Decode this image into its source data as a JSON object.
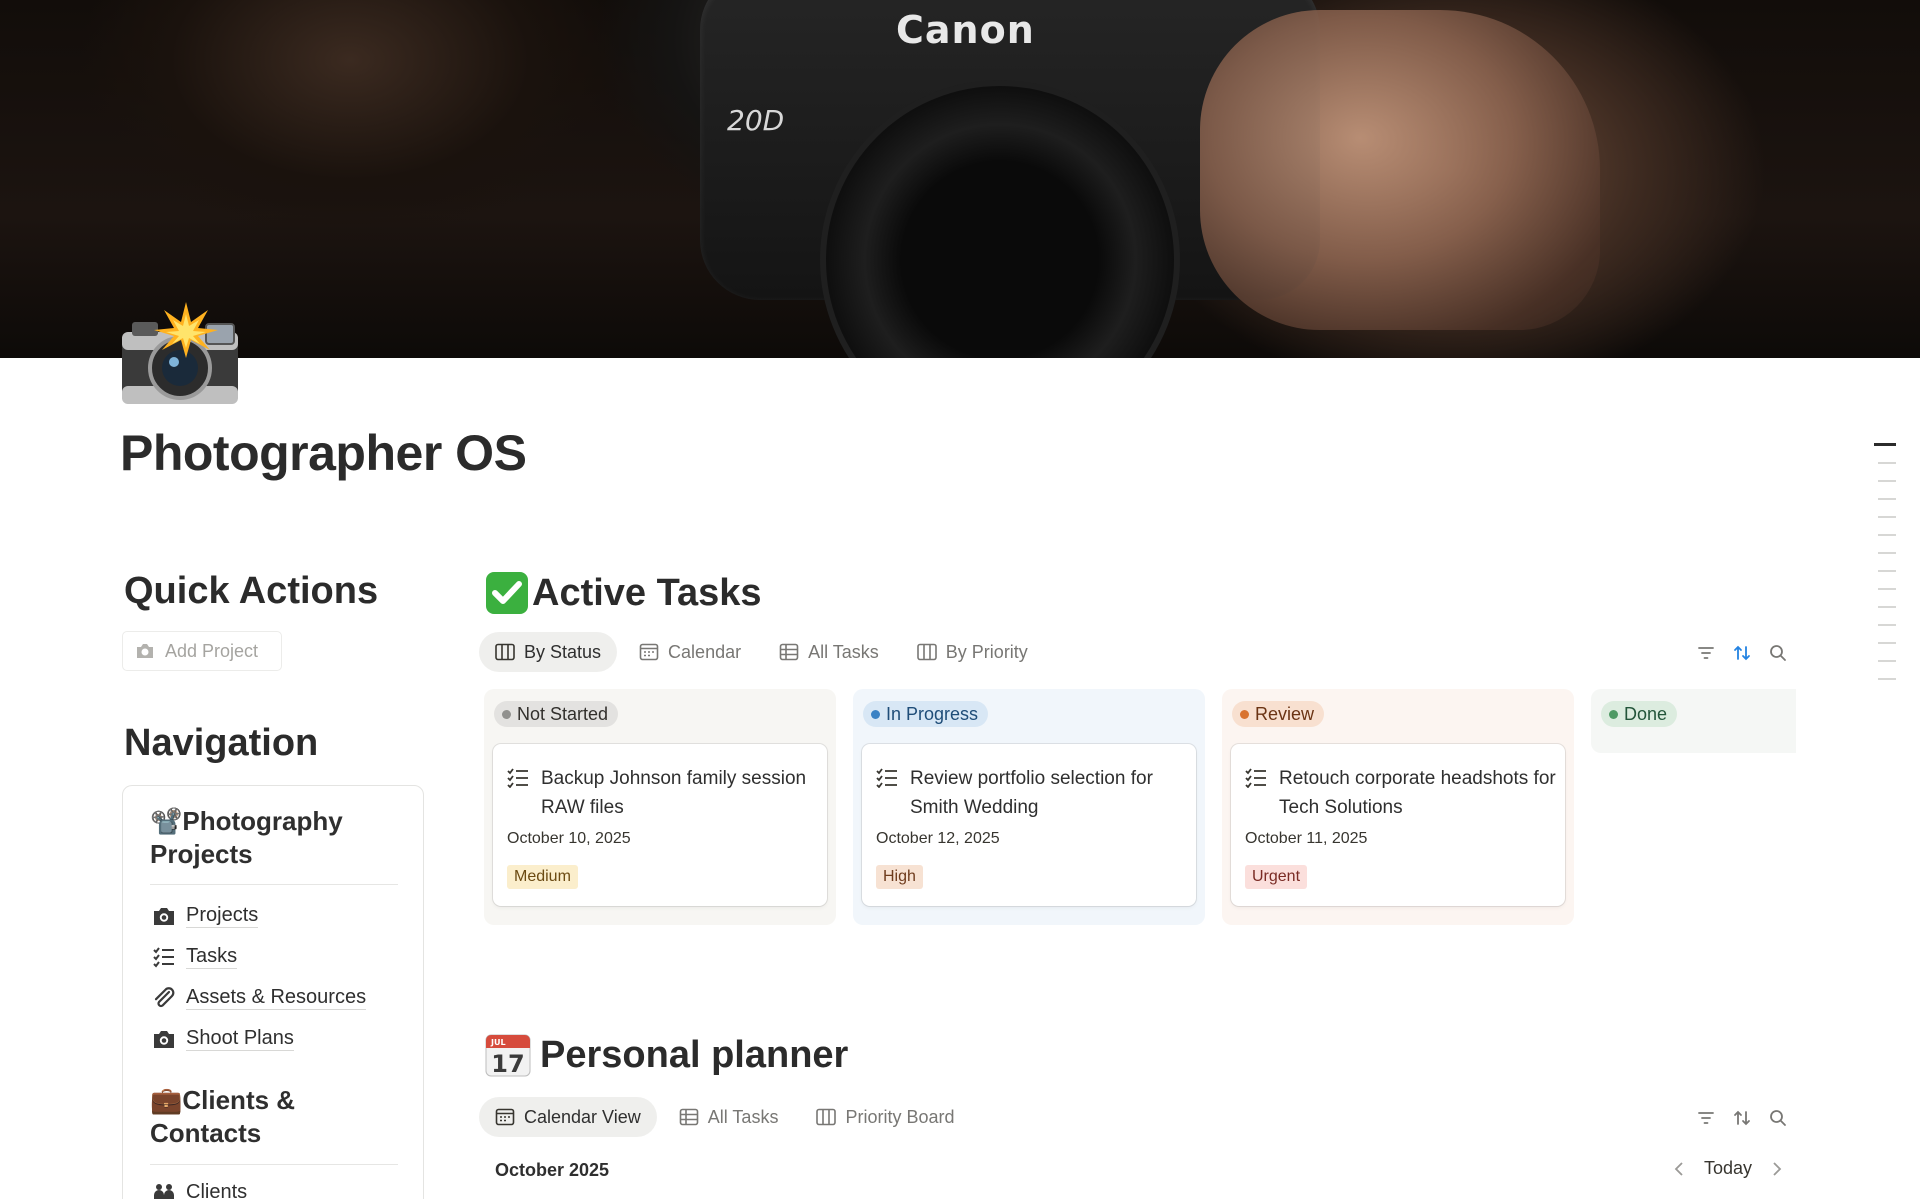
{
  "page": {
    "title": "Photographer OS",
    "cover": {
      "brand_text": "Canon",
      "model_text": "20D"
    }
  },
  "quick_actions": {
    "heading": "Quick Actions",
    "add_project_label": "Add Project"
  },
  "navigation": {
    "heading": "Navigation",
    "groups": [
      {
        "emoji": "📽️",
        "title": "Photography Projects",
        "items": [
          {
            "icon": "camera-icon",
            "label": "Projects"
          },
          {
            "icon": "checklist-icon",
            "label": "Tasks"
          },
          {
            "icon": "paperclip-icon",
            "label": "Assets & Resources"
          },
          {
            "icon": "camera-icon",
            "label": "Shoot Plans"
          }
        ]
      },
      {
        "emoji": "💼",
        "title": "Clients & Contacts",
        "items": [
          {
            "icon": "people-icon",
            "label": "Clients"
          }
        ]
      }
    ]
  },
  "active_tasks": {
    "heading": "Active Tasks",
    "tabs": [
      {
        "label": "By Status",
        "icon": "board-icon",
        "active": true
      },
      {
        "label": "Calendar",
        "icon": "calendar-icon",
        "active": false
      },
      {
        "label": "All Tasks",
        "icon": "table-icon",
        "active": false
      },
      {
        "label": "By Priority",
        "icon": "board-icon",
        "active": false
      }
    ],
    "columns": [
      {
        "status": "Not Started",
        "colors": {
          "bg": "#f7f6f3",
          "pill": "#e3e2e0",
          "dot": "#91918e",
          "text": "#32302c"
        },
        "cards": [
          {
            "title": "Backup Johnson family session RAW files",
            "date": "October 10, 2025",
            "priority": "Medium",
            "priority_bg": "#fbeecc",
            "priority_fg": "#6b4a12"
          }
        ]
      },
      {
        "status": "In Progress",
        "colors": {
          "bg": "#f1f6fb",
          "pill": "#d8e7f5",
          "dot": "#3b82c4",
          "text": "#1f4d78"
        },
        "cards": [
          {
            "title": "Review portfolio selection for Smith Wedding",
            "date": "October 12, 2025",
            "priority": "High",
            "priority_bg": "#f7e2d3",
            "priority_fg": "#6e3b1c"
          }
        ]
      },
      {
        "status": "Review",
        "colors": {
          "bg": "#fcf5f1",
          "pill": "#f8e0d0",
          "dot": "#d9732f",
          "text": "#6b3414"
        },
        "cards": [
          {
            "title": "Retouch corporate headshots for Tech Solutions",
            "date": "October 11, 2025",
            "priority": "Urgent",
            "priority_bg": "#fbdfdc",
            "priority_fg": "#7a2b24"
          }
        ]
      },
      {
        "status": "Done",
        "colors": {
          "bg": "#f5f7f5",
          "pill": "#dcecdf",
          "dot": "#4f9a64",
          "text": "#23553a"
        },
        "cards": []
      }
    ]
  },
  "personal_planner": {
    "heading": "Personal planner",
    "calendar_icon": {
      "month": "JUL",
      "day": "17"
    },
    "tabs": [
      {
        "label": "Calendar View",
        "icon": "calendar-icon",
        "active": true
      },
      {
        "label": "All Tasks",
        "icon": "table-icon",
        "active": false
      },
      {
        "label": "Priority Board",
        "icon": "board-icon",
        "active": false
      }
    ],
    "month_label": "October 2025",
    "today_label": "Today"
  }
}
